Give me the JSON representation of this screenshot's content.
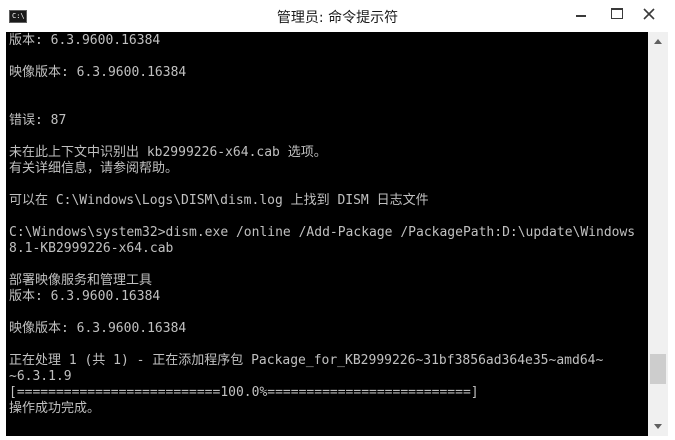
{
  "window": {
    "icon_label": "C:\\",
    "title": "管理员: 命令提示符"
  },
  "console": {
    "lines": [
      "版本: 6.3.9600.16384",
      "",
      "映像版本: 6.3.9600.16384",
      "",
      "",
      "错误: 87",
      "",
      "未在此上下文中识别出 kb2999226-x64.cab 选项。",
      "有关详细信息，请参阅帮助。",
      "",
      "可以在 C:\\Windows\\Logs\\DISM\\dism.log 上找到 DISM 日志文件",
      "",
      "C:\\Windows\\system32>dism.exe /online /Add-Package /PackagePath:D:\\update\\Windows",
      "8.1-KB2999226-x64.cab",
      "",
      "部署映像服务和管理工具",
      "版本: 6.3.9600.16384",
      "",
      "映像版本: 6.3.9600.16384",
      "",
      "正在处理 1 (共 1) - 正在添加程序包 Package_for_KB2999226~31bf3856ad364e35~amd64~",
      "~6.3.1.9",
      "[==========================100.0%==========================]",
      "操作成功完成。"
    ],
    "progress_percent": 100.0,
    "text_color": "#c0c0c0",
    "background_color": "#000000"
  },
  "scrollbar": {
    "position_fraction": 0.9
  }
}
